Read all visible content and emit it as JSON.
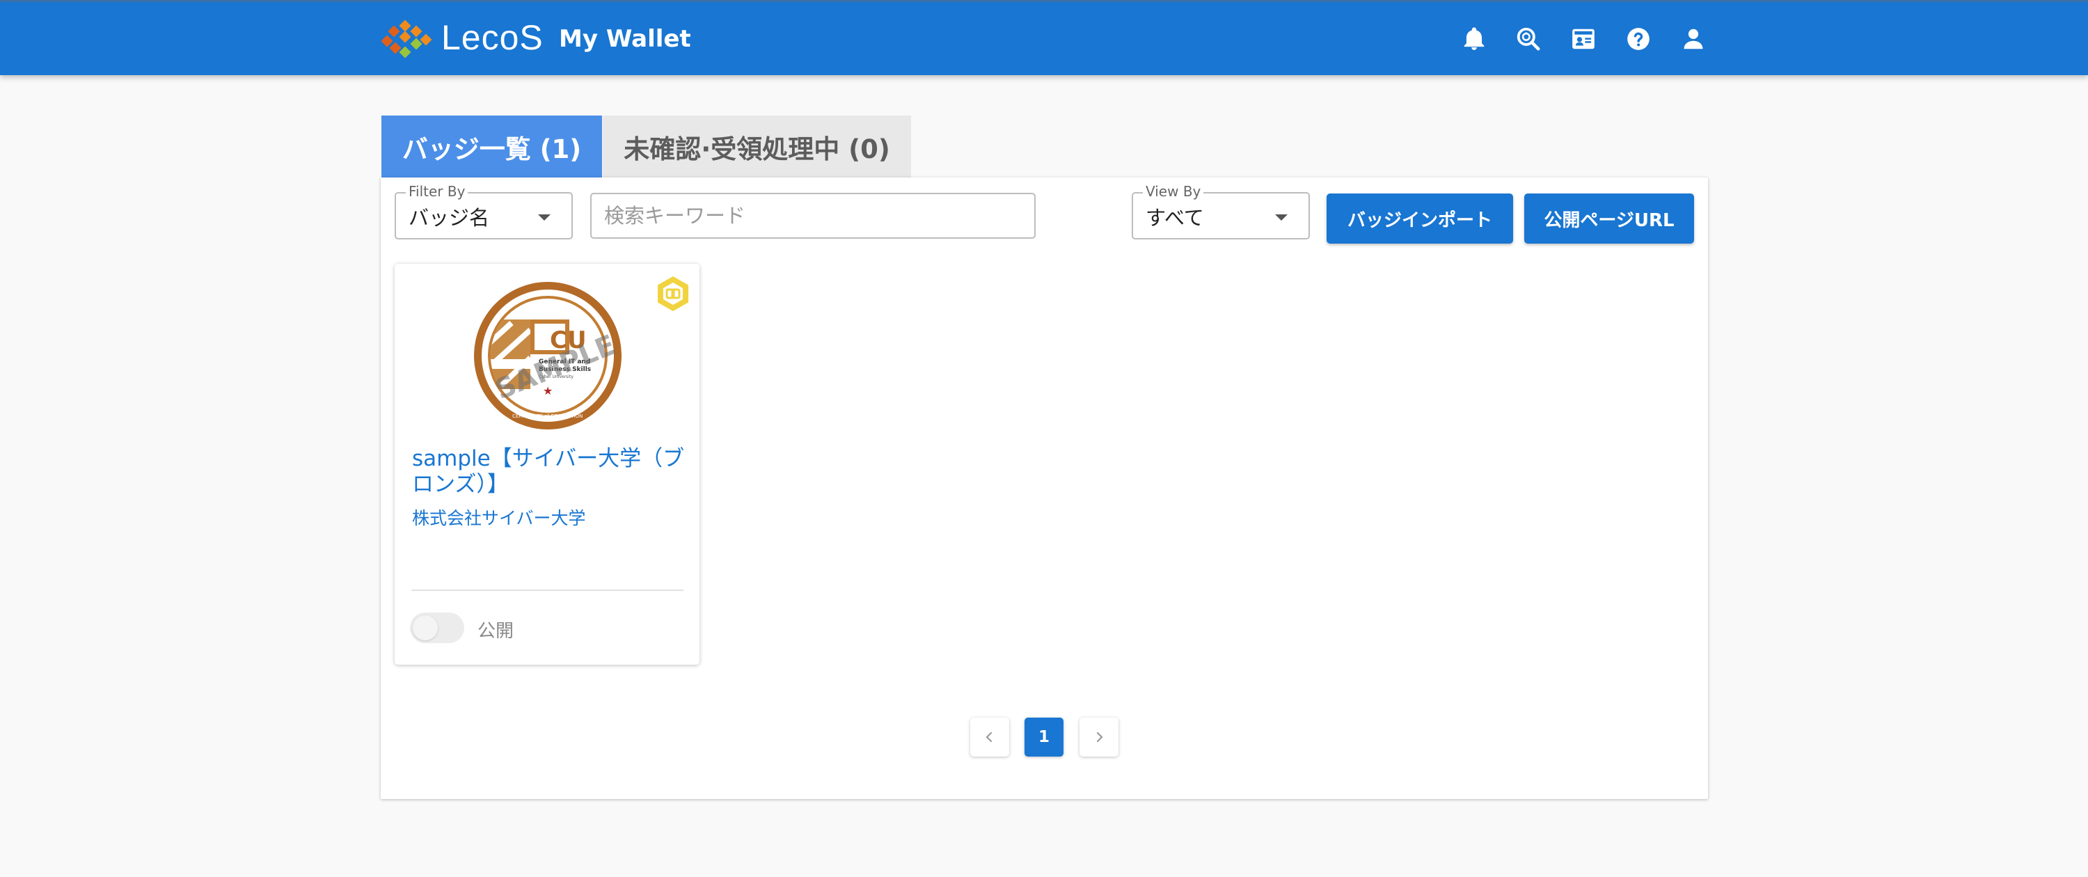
{
  "header": {
    "brand": "LecoS",
    "app_title": "My Wallet",
    "icons": [
      "bell-icon",
      "search-badge-icon",
      "id-card-icon",
      "help-icon",
      "user-icon"
    ],
    "accent_color": "#1976d2"
  },
  "tabs": [
    {
      "label": "バッジ一覧 (1)",
      "active": true
    },
    {
      "label": "未確認·受領処理中 (0)",
      "active": false
    }
  ],
  "filters": {
    "filter_by": {
      "legend": "Filter By",
      "value": "バッジ名"
    },
    "search": {
      "placeholder": "検索キーワード",
      "value": ""
    },
    "view_by": {
      "legend": "View By",
      "value": "すべて"
    }
  },
  "buttons": {
    "import": "バッジインポート",
    "public_url": "公開ページURL"
  },
  "badges": [
    {
      "title": "sample【サイバー大学（ブロンズ）】",
      "issuer": "株式会社サイバー大学",
      "public_label": "公開",
      "public_enabled": false,
      "image": {
        "watermark": "SAMPLE",
        "monogram": "CU",
        "line1": "General IT and",
        "line2": "Business Skills",
        "line3": "Cyber University",
        "ring_text": "CERTIFICATE of COMPLETION"
      }
    }
  ],
  "pagination": {
    "current": "1",
    "prev_icon": "chevron-left-icon",
    "next_icon": "chevron-right-icon"
  }
}
